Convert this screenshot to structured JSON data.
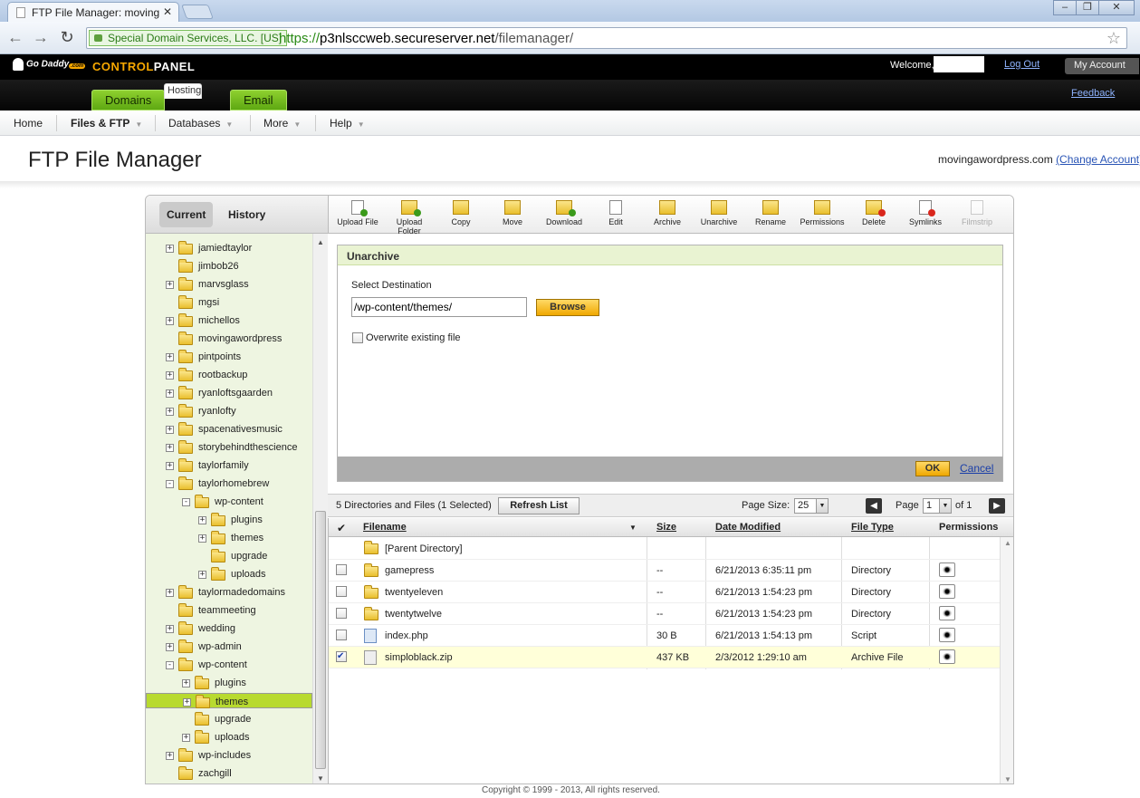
{
  "browser": {
    "tab_title": "FTP File Manager: moving",
    "ev_label": "Special Domain Services, LLC. [US]",
    "url_scheme": "https://",
    "url_host": "p3nlsccweb.secureserver.net",
    "url_path": "/filemanager/"
  },
  "header": {
    "logo_text": "Go Daddy",
    "logo_com": ".com",
    "cp_part1": "CONTROL",
    "cp_part2": "PANEL",
    "welcome": "Welcome,",
    "logout": "Log Out",
    "my_account": "My Account",
    "feedback": "Feedback",
    "tabs": [
      "Domains",
      "Hosting",
      "Email"
    ]
  },
  "menu": {
    "items": [
      "Home",
      "Files & FTP",
      "Databases",
      "More",
      "Help"
    ]
  },
  "page": {
    "title": "FTP File Manager",
    "account_domain": "movingawordpress.com",
    "change_account": "(Change Account)"
  },
  "left": {
    "tabs": [
      "Current",
      "History"
    ],
    "tree": [
      {
        "label": "jamiedtaylor",
        "exp": "+"
      },
      {
        "label": "jimbob26",
        "exp": ""
      },
      {
        "label": "marvsglass",
        "exp": "+"
      },
      {
        "label": "mgsi",
        "exp": ""
      },
      {
        "label": "michellos",
        "exp": "+"
      },
      {
        "label": "movingawordpress",
        "exp": ""
      },
      {
        "label": "pintpoints",
        "exp": "+"
      },
      {
        "label": "rootbackup",
        "exp": "+"
      },
      {
        "label": "ryanloftsgaarden",
        "exp": "+"
      },
      {
        "label": "ryanlofty",
        "exp": "+"
      },
      {
        "label": "spacenativesmusic",
        "exp": "+"
      },
      {
        "label": "storybehindthescience",
        "exp": "+"
      },
      {
        "label": "taylorfamily",
        "exp": "+"
      },
      {
        "label": "taylorhomebrew",
        "exp": "−"
      },
      {
        "label": "wp-content",
        "exp": "−"
      },
      {
        "label": "plugins",
        "exp": "+"
      },
      {
        "label": "themes",
        "exp": "+"
      },
      {
        "label": "upgrade",
        "exp": ""
      },
      {
        "label": "uploads",
        "exp": "+"
      },
      {
        "label": "taylormadedomains",
        "exp": "+"
      },
      {
        "label": "teammeeting",
        "exp": ""
      },
      {
        "label": "wedding",
        "exp": "+"
      },
      {
        "label": "wp-admin",
        "exp": "+"
      },
      {
        "label": "wp-content",
        "exp": "−"
      },
      {
        "label": "plugins",
        "exp": "+"
      },
      {
        "label": "themes",
        "exp": "+"
      },
      {
        "label": "upgrade",
        "exp": ""
      },
      {
        "label": "uploads",
        "exp": "+"
      },
      {
        "label": "wp-includes",
        "exp": "+"
      },
      {
        "label": "zachgill",
        "exp": ""
      }
    ]
  },
  "tools": [
    "Upload File",
    "Upload Folder",
    "Copy",
    "Move",
    "Download",
    "Edit",
    "Archive",
    "Unarchive",
    "Rename",
    "Permissions",
    "Delete",
    "Symlinks",
    "Filmstrip"
  ],
  "unarchive": {
    "title": "Unarchive",
    "dest_label": "Select Destination",
    "dest_value": "/wp-content/themes/",
    "browse": "Browse",
    "overwrite": "Overwrite existing file",
    "ok": "OK",
    "cancel": "Cancel"
  },
  "list": {
    "count": "5 Directories and Files (1 Selected)",
    "refresh": "Refresh List",
    "page_size_label": "Page Size:",
    "page_size": "25",
    "page_label": "Page",
    "page_num": "1",
    "of": "of 1",
    "columns": [
      "Filename",
      "Size",
      "Date Modified",
      "File Type",
      "Permissions"
    ],
    "parent": "[Parent Directory]",
    "rows": [
      {
        "name": "gamepress",
        "size": "--",
        "date": "6/21/2013 6:35:11 pm",
        "type": "Directory"
      },
      {
        "name": "twentyeleven",
        "size": "--",
        "date": "6/21/2013 1:54:23 pm",
        "type": "Directory"
      },
      {
        "name": "twentytwelve",
        "size": "--",
        "date": "6/21/2013 1:54:23 pm",
        "type": "Directory"
      },
      {
        "name": "index.php",
        "size": "30 B",
        "date": "6/21/2013 1:54:13 pm",
        "type": "Script"
      },
      {
        "name": "simploblack.zip",
        "size": "437 KB",
        "date": "2/3/2012 1:29:10 am",
        "type": "Archive File"
      }
    ]
  },
  "footer": {
    "copyright": "Copyright © 1999 - 2013, All rights reserved."
  }
}
